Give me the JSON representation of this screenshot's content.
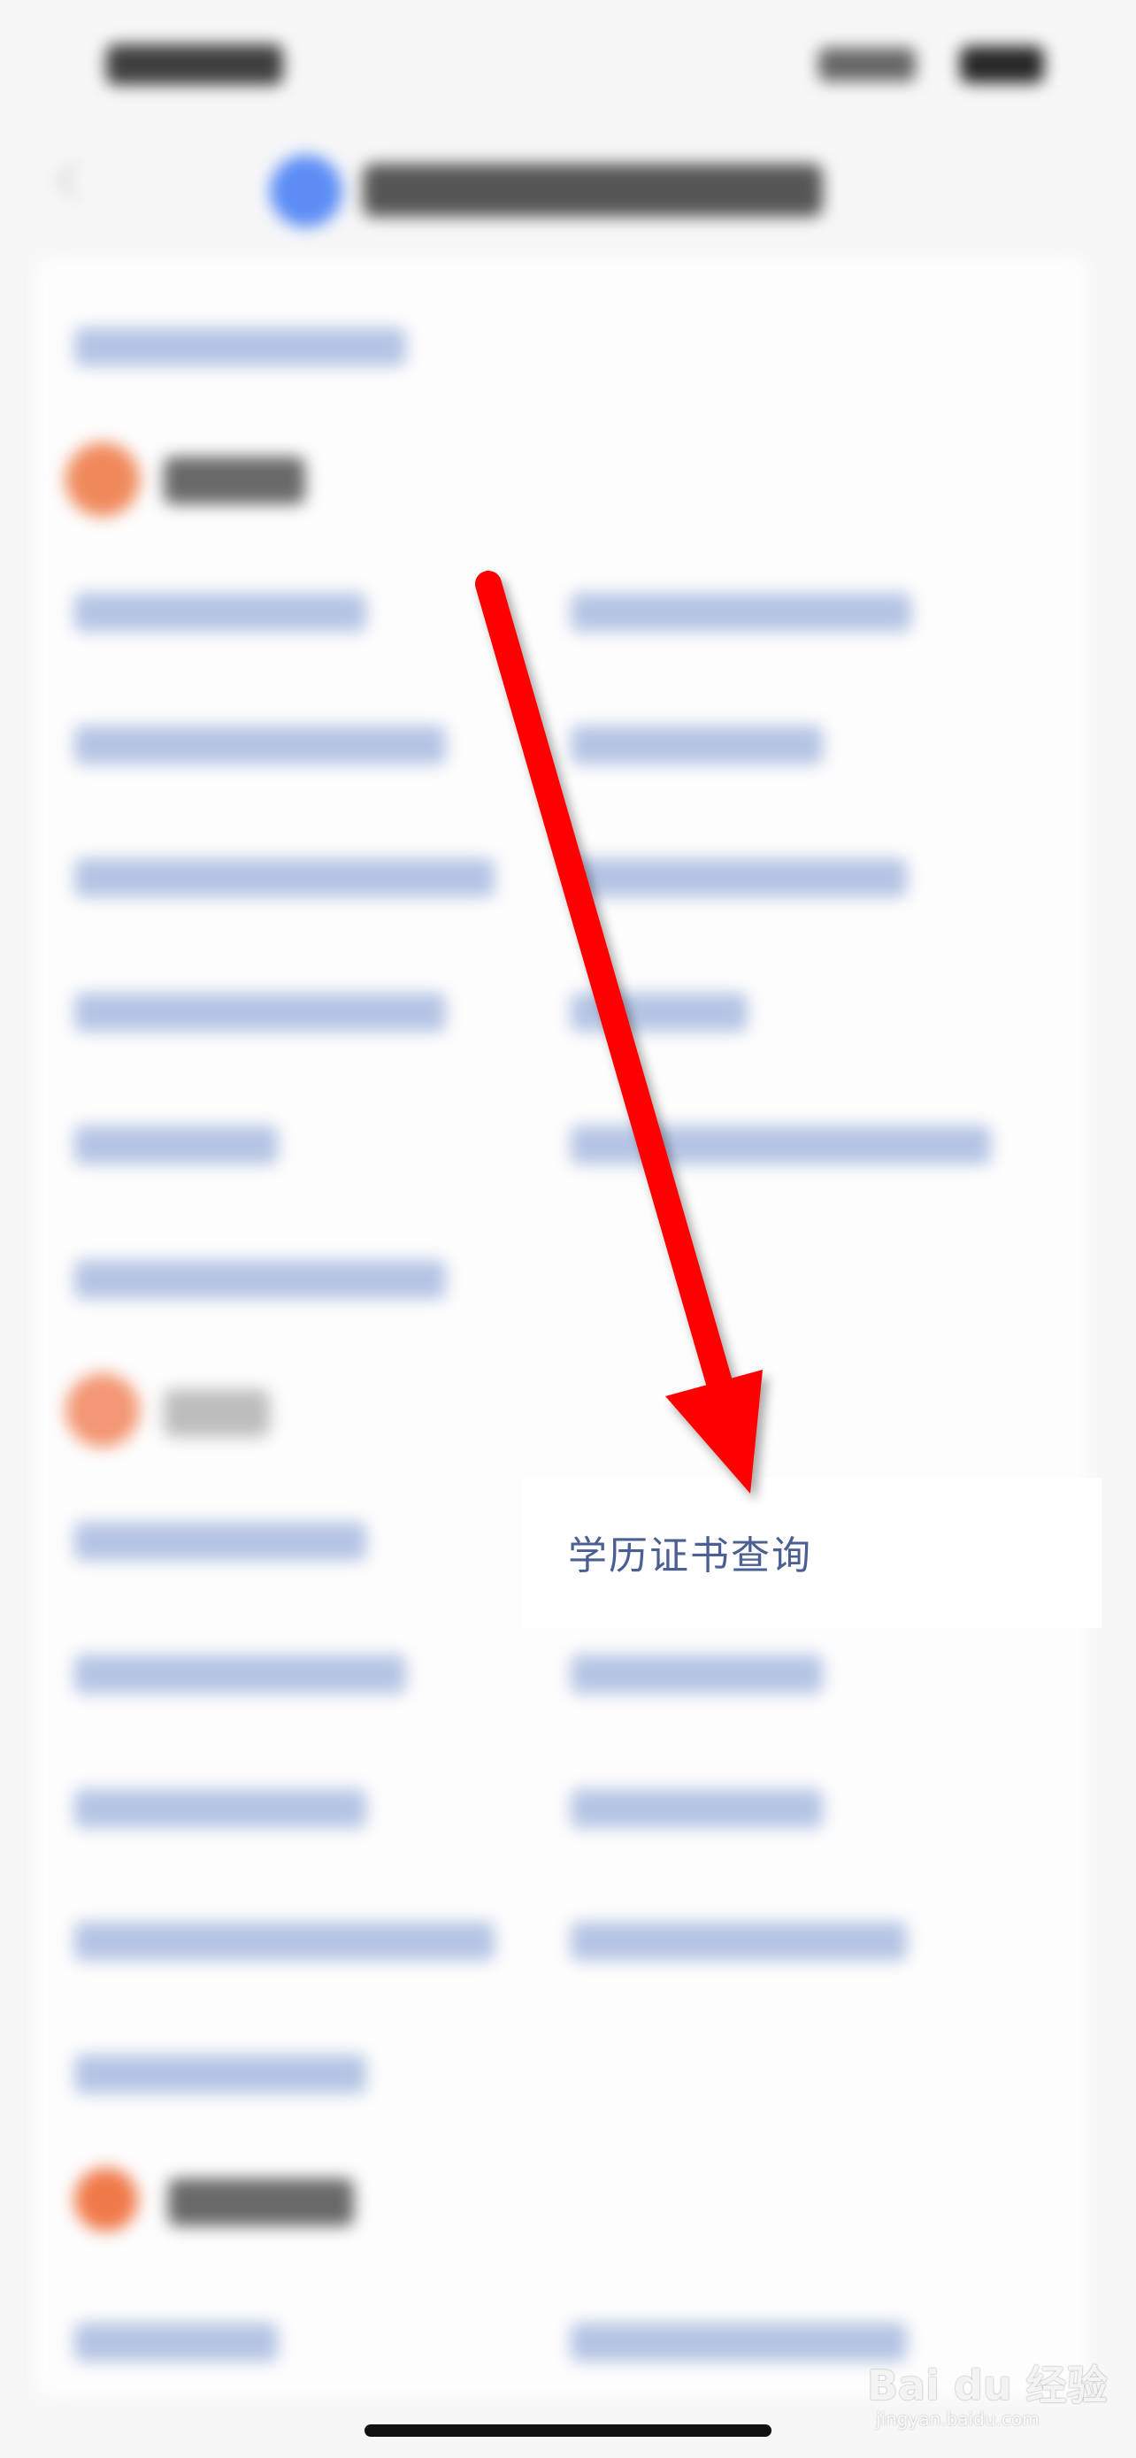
{
  "highlighted_item": {
    "label": "学历证书查询"
  },
  "watermark": {
    "brand": "Bai du 经验",
    "site": "jingyan.baidu.com"
  },
  "colors": {
    "link_text": "#4a5f93",
    "arrow": "#ff0000",
    "section_accent": "#f08050",
    "logo": "#5b8df5"
  },
  "icons": {
    "back": "chevron-left-icon",
    "arrow": "arrow-down-icon"
  }
}
